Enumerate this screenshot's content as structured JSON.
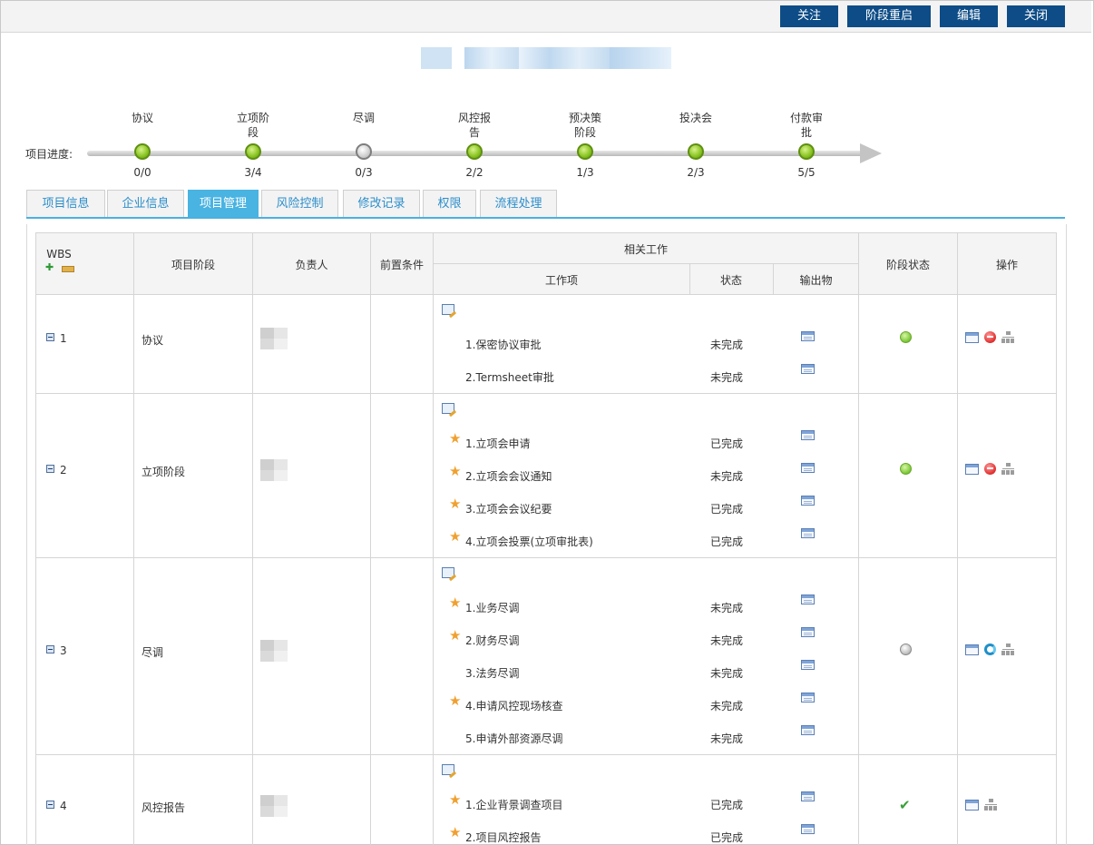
{
  "toolbar": {
    "follow": "关注",
    "restart": "阶段重启",
    "edit": "编辑",
    "close": "关闭"
  },
  "progress": {
    "label": "项目进度:",
    "stages": [
      {
        "name_lines": [
          "协议"
        ],
        "count": "0/0",
        "status": "green"
      },
      {
        "name_lines": [
          "立项阶",
          "段"
        ],
        "count": "3/4",
        "status": "green"
      },
      {
        "name_lines": [
          "尽调"
        ],
        "count": "0/3",
        "status": "gray"
      },
      {
        "name_lines": [
          "风控报",
          "告"
        ],
        "count": "2/2",
        "status": "green"
      },
      {
        "name_lines": [
          "预决策",
          "阶段"
        ],
        "count": "1/3",
        "status": "green"
      },
      {
        "name_lines": [
          "投决会"
        ],
        "count": "2/3",
        "status": "green"
      },
      {
        "name_lines": [
          "付款审",
          "批"
        ],
        "count": "5/5",
        "status": "green"
      }
    ]
  },
  "tabs": [
    "项目信息",
    "企业信息",
    "项目管理",
    "风险控制",
    "修改记录",
    "权限",
    "流程处理"
  ],
  "active_tab": 2,
  "table": {
    "headers": {
      "wbs": "WBS",
      "stage": "项目阶段",
      "owner": "负责人",
      "precondition": "前置条件",
      "related_work": "相关工作",
      "work_item": "工作项",
      "status": "状态",
      "output": "输出物",
      "stage_status": "阶段状态",
      "operation": "操作"
    },
    "rows": [
      {
        "wbs": "1",
        "stage": "协议",
        "stage_status": "green",
        "ops": [
          "view",
          "delete",
          "org"
        ],
        "items": [
          {
            "text": "1.保密协议审批",
            "status": "未完成",
            "star": false
          },
          {
            "text": "2.Termsheet审批",
            "status": "未完成",
            "star": false
          }
        ]
      },
      {
        "wbs": "2",
        "stage": "立项阶段",
        "stage_status": "green",
        "ops": [
          "view",
          "delete",
          "org"
        ],
        "items": [
          {
            "text": "1.立项会申请",
            "status": "已完成",
            "star": true
          },
          {
            "text": "2.立项会会议通知",
            "status": "未完成",
            "star": true
          },
          {
            "text": "3.立项会会议纪要",
            "status": "已完成",
            "star": true
          },
          {
            "text": "4.立项会投票(立项审批表)",
            "status": "已完成",
            "star": true
          }
        ]
      },
      {
        "wbs": "3",
        "stage": "尽调",
        "stage_status": "gray",
        "ops": [
          "view",
          "reset",
          "org"
        ],
        "items": [
          {
            "text": "1.业务尽调",
            "status": "未完成",
            "star": true
          },
          {
            "text": "2.财务尽调",
            "status": "未完成",
            "star": true
          },
          {
            "text": "3.法务尽调",
            "status": "未完成",
            "star": false
          },
          {
            "text": "4.申请风控现场核查",
            "status": "未完成",
            "star": true
          },
          {
            "text": "5.申请外部资源尽调",
            "status": "未完成",
            "star": false
          }
        ]
      },
      {
        "wbs": "4",
        "stage": "风控报告",
        "stage_status": "check",
        "ops": [
          "view",
          "org"
        ],
        "items": [
          {
            "text": "1.企业背景调查项目",
            "status": "已完成",
            "star": true
          },
          {
            "text": "2.项目风控报告",
            "status": "已完成",
            "star": true
          }
        ]
      }
    ]
  },
  "icons": {
    "add": "add-icon",
    "edit": "edit-icon",
    "star": "star-icon",
    "output": "document-icon",
    "view": "view-icon",
    "delete": "delete-icon",
    "reset": "reset-icon",
    "org": "org-chart-icon",
    "collapse": "collapse-icon",
    "check": "check-icon"
  },
  "colors": {
    "button_bg": "#0d4c86",
    "tab_active": "#49b3e2",
    "tab_text": "#2b8ecb",
    "status_green": "#7fcb3a",
    "star": "#f0a030"
  }
}
